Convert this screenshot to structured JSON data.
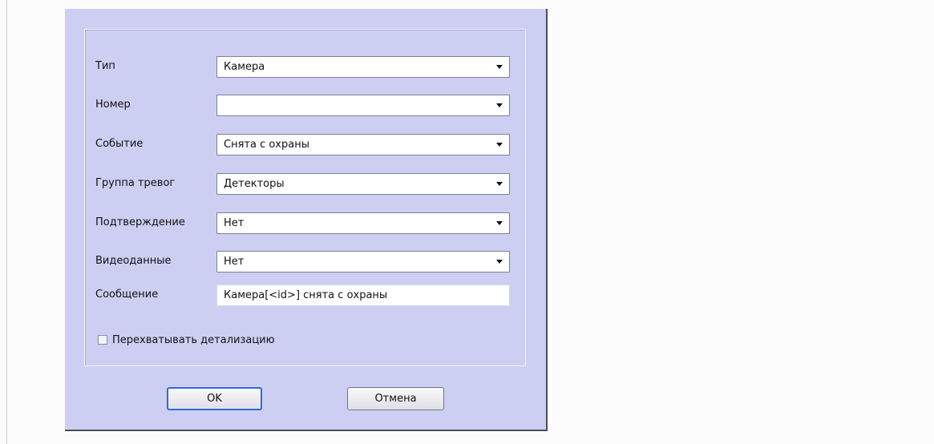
{
  "dialog": {
    "fields": [
      {
        "label": "Тип",
        "value": "Камера"
      },
      {
        "label": "Номер",
        "value": ""
      },
      {
        "label": "Событие",
        "value": "Снята с охраны"
      },
      {
        "label": "Группа тревог",
        "value": "Детекторы"
      },
      {
        "label": "Подтверждение",
        "value": "Нет"
      },
      {
        "label": "Видеоданные",
        "value": "Нет"
      }
    ],
    "message": {
      "label": "Сообщение",
      "value": "Камера[<id>] снята с охраны"
    },
    "intercept": {
      "label": "Перехватывать детализацию",
      "checked": false
    },
    "buttons": {
      "ok": "OK",
      "cancel": "Отмена"
    }
  },
  "colors": {
    "dialog_background": "#cdcff2",
    "focus_border": "#3568d7"
  },
  "icons": {
    "dropdown": "chevron-down-icon",
    "checkbox": "checkbox-icon"
  }
}
